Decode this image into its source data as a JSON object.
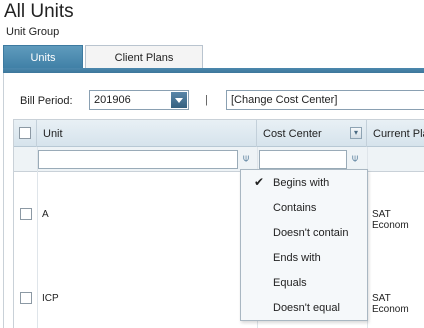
{
  "page": {
    "title": "All Units",
    "subtitle": "Unit Group"
  },
  "tabs": [
    {
      "label": "Units",
      "active": true
    },
    {
      "label": "Client Plans",
      "active": false
    }
  ],
  "bill_period": {
    "label": "Bill Period:",
    "value": "201906"
  },
  "separator": "|",
  "cost_center": {
    "value": "[Change Cost Center]"
  },
  "grid": {
    "columns": [
      "Unit",
      "Cost Center",
      "Current Pla"
    ],
    "rows": [
      {
        "unit": "A",
        "current_plan": "SAT Econom"
      },
      {
        "unit": "ICP",
        "current_plan": "SAT Econom"
      }
    ]
  },
  "filter_menu": {
    "items": [
      "Begins with",
      "Contains",
      "Doesn't contain",
      "Ends with",
      "Equals",
      "Doesn't equal"
    ],
    "selected": "Begins with",
    "check_glyph": "✔"
  },
  "icons": {
    "filter": "filter-pin-icon",
    "sort": "sort-icon",
    "dropdown": "chevron-down-icon"
  },
  "colors": {
    "active_tab": "#4a8ab2",
    "header_bg": "#dbe7ef",
    "menu_bg": "#f5f8fa"
  }
}
